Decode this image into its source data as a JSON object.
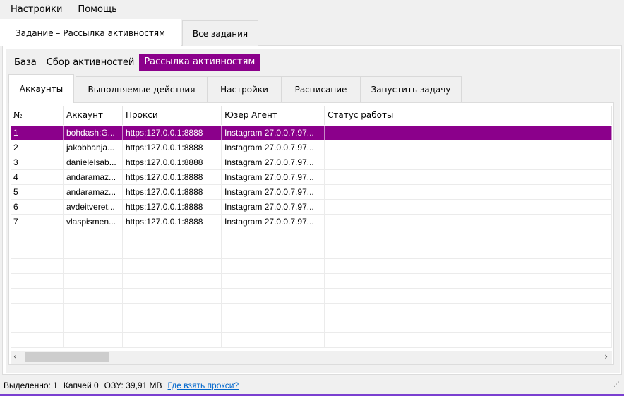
{
  "menu": [
    "Настройки",
    "Помощь"
  ],
  "outer_tabs": [
    "Задание – Рассылка активностям",
    "Все задания"
  ],
  "nav": [
    "База",
    "Сбор активностей",
    "Рассылка активностям"
  ],
  "tabs": [
    "Аккаунты",
    "Выполняемые действия",
    "Настройки",
    "Расписание",
    "Запустить задачу"
  ],
  "table": {
    "columns": [
      "№",
      "Аккаунт",
      "Прокси",
      "Юзер Агент",
      "Статус работы"
    ],
    "rows": [
      [
        "1",
        "bohdash:G...",
        "https:127.0.0.1:8888",
        "Instagram 27.0.0.7.97...",
        ""
      ],
      [
        "2",
        "jakobbanja...",
        "https:127.0.0.1:8888",
        "Instagram 27.0.0.7.97...",
        ""
      ],
      [
        "3",
        "danielelsab...",
        "https:127.0.0.1:8888",
        "Instagram 27.0.0.7.97...",
        ""
      ],
      [
        "4",
        "andaramaz...",
        "https:127.0.0.1:8888",
        "Instagram 27.0.0.7.97...",
        ""
      ],
      [
        "5",
        "andaramaz...",
        "https:127.0.0.1:8888",
        "Instagram 27.0.0.7.97...",
        ""
      ],
      [
        "6",
        "avdeitveret...",
        "https:127.0.0.1:8888",
        "Instagram 27.0.0.7.97...",
        ""
      ],
      [
        "7",
        "vlaspismen...",
        "https:127.0.0.1:8888",
        "Instagram 27.0.0.7.97...",
        ""
      ]
    ]
  },
  "status": {
    "selected": "Выделенно: 1",
    "captcha": "Капчей 0",
    "ram": "ОЗУ: 39,91 MB",
    "link": "Где взять прокси?"
  },
  "colors": {
    "accent": "#8b008b"
  }
}
